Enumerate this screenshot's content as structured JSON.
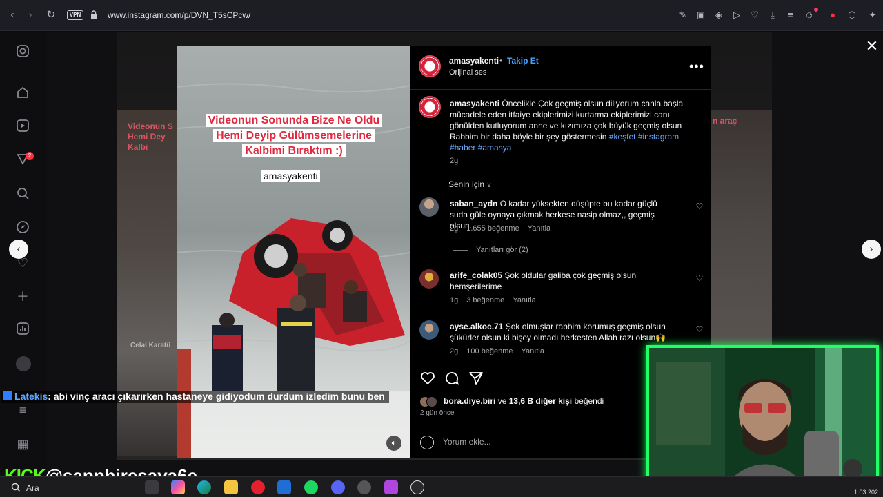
{
  "browser": {
    "url": "www.instagram.com/p/DVN_T5sCPcw/",
    "vpn_label": "VPN"
  },
  "background": {
    "caption_left": "Videonun S Hemi Dey Kalbi",
    "caption_right": "n araç",
    "name_left": "Celal Karatü",
    "notification_count": "2"
  },
  "video": {
    "title_line1": "Videonun Sonunda Bize Ne Oldu",
    "title_line2": "Hemi Deyip Gülümsemelerine",
    "title_line3": "Kalbimi Bıraktım :)",
    "watermark": "amasyakenti"
  },
  "post": {
    "author": "amasyakenti",
    "separator": "•",
    "follow_label": "Takip Et",
    "audio_label": "Orijinal ses",
    "caption": {
      "username": "amasyakenti",
      "text": "Öncelikle Çok geçmiş olsun diliyorum canla başla mücadele eden itfaiye ekiplerimizi kurtarma ekiplerimizi canı gönülden kutluyorum anne ve kızımıza çok büyük geçmiş olsun Rabbim bir daha böyle bir şey göstermesin",
      "hashtags": "#keşfet #instagram #haber #amasya",
      "time": "2g"
    },
    "sort_label": "Senin için",
    "comments": [
      {
        "username": "saban_aydn",
        "text": "O kadar yüksekten düşüpte bu kadar güçlü suda güle oynaya çıkmak herkese nasip olmaz,, geçmiş olsun..",
        "time": "2g",
        "likes": "1.655 beğenme",
        "reply": "Yanıtla"
      },
      {
        "username": "arife_colak05",
        "text": "Şok oldular galiba çok geçmiş olsun hemşerilerime",
        "time": "1g",
        "likes": "3 beğenme",
        "reply": "Yanıtla"
      },
      {
        "username": "ayse.alkoc.71",
        "text": "Şok olmuşlar rabbim korumuş geçmiş olsun şükürler olsun ki bişey olmadı herkesten Allah razı olsun🙌",
        "time": "2g",
        "likes": "100 beğenme",
        "reply": "Yanıtla"
      }
    ],
    "view_replies": "Yanıtları gör (2)",
    "liked_by_user": "bora.diye.biri",
    "liked_by_connector": "ve",
    "liked_by_others": "13,6 B diğer kişi",
    "liked_by_suffix": "beğendi",
    "time_ago": "2 gün önce",
    "comment_placeholder": "Yorum ekle..."
  },
  "chat": {
    "user": "Latekis",
    "message": ": abi vinç aracı çıkarırken hastaneye gidiyodum durdum izledim bunu ben"
  },
  "stream": {
    "kick_logo": "KICK",
    "handle": "@sapphiresava6e"
  },
  "taskbar": {
    "search_label": "Ara",
    "clock": "1.03.202"
  },
  "colors": {
    "accent_link": "#4aa3ff",
    "kick_green": "#53fc18",
    "video_title_red": "#e0283e",
    "cam_border": "#22ff66"
  }
}
